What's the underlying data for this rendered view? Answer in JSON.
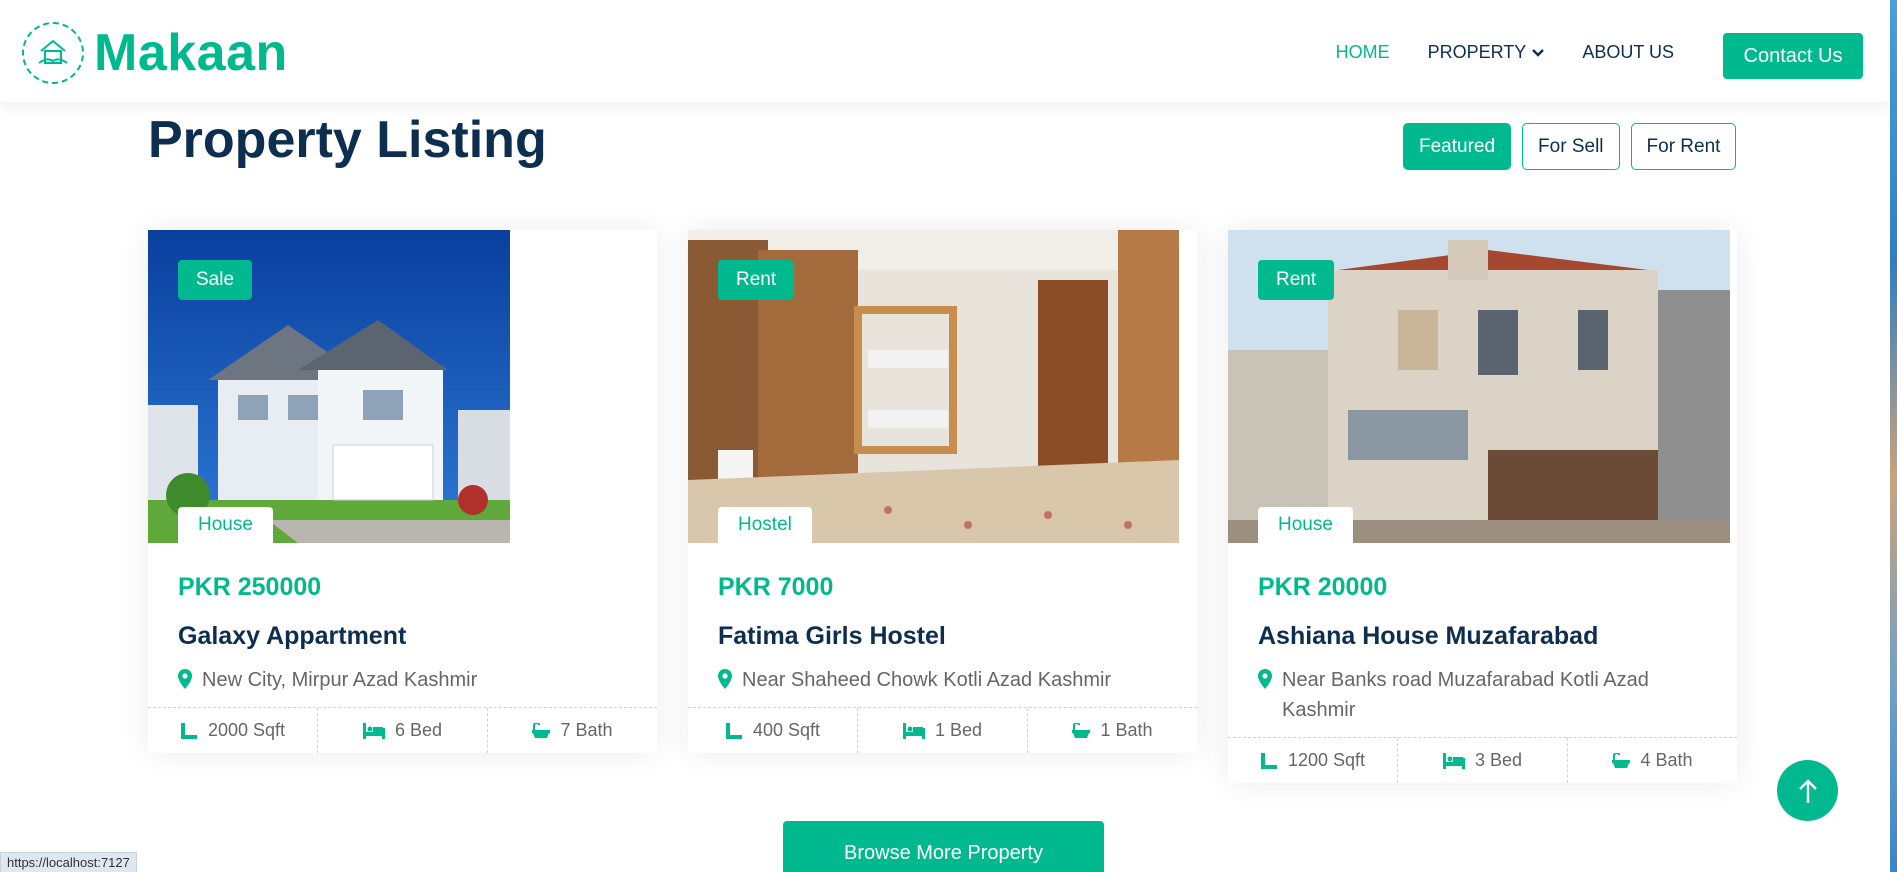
{
  "brand": {
    "name": "Makaan",
    "icon": "handshake-house-icon"
  },
  "nav": {
    "home": "HOME",
    "property": "PROPERTY",
    "about": "ABOUT US",
    "contact": "Contact Us"
  },
  "section": {
    "title": "Property Listing",
    "filters": [
      "Featured",
      "For Sell",
      "For Rent"
    ]
  },
  "listings": [
    {
      "badge": "Sale",
      "type": "House",
      "price": "PKR 250000",
      "name": "Galaxy Appartment",
      "address": "New City, Mirpur Azad Kashmir",
      "area": "2000 Sqft",
      "beds": "6 Bed",
      "baths": "7 Bath"
    },
    {
      "badge": "Rent",
      "type": "Hostel",
      "price": "PKR 7000",
      "name": "Fatima Girls Hostel",
      "address": "Near Shaheed Chowk Kotli Azad Kashmir",
      "area": "400 Sqft",
      "beds": "1 Bed",
      "baths": "1 Bath"
    },
    {
      "badge": "Rent",
      "type": "House",
      "price": "PKR 20000",
      "name": "Ashiana House Muzafarabad",
      "address": "Near Banks road Muzafarabad Kotli Azad Kashmir",
      "area": "1200 Sqft",
      "beds": "3 Bed",
      "baths": "4 Bath"
    }
  ],
  "browse_label": "Browse More Property",
  "status_url": "https://localhost:7127",
  "colors": {
    "primary": "#00b98e",
    "dark": "#0e2e50",
    "muted": "#666666"
  }
}
